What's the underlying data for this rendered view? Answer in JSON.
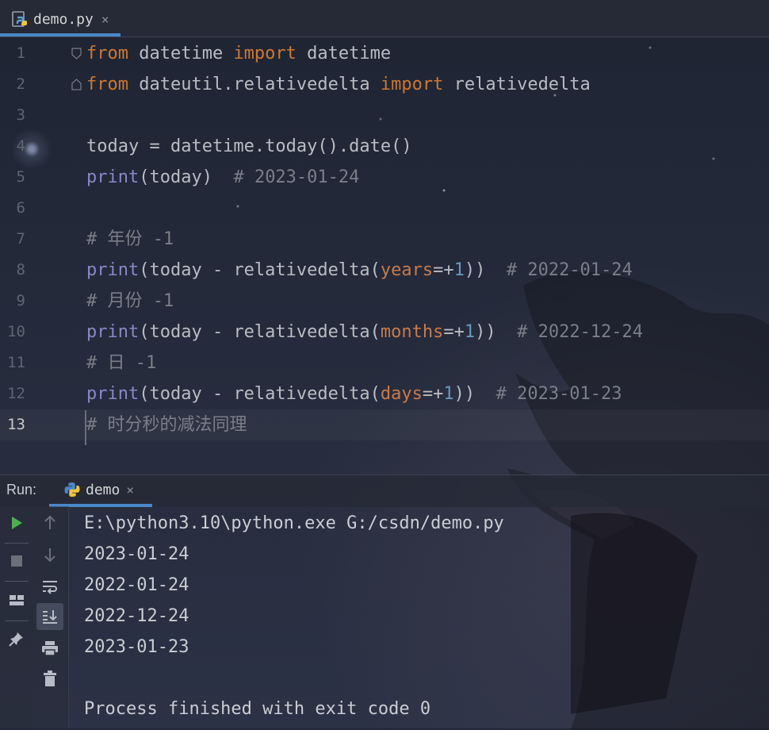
{
  "editor_tab": {
    "label": "demo.py",
    "close": "×"
  },
  "code_lines": [
    {
      "n": "1",
      "tokens": [
        {
          "t": "from",
          "c": "kw"
        },
        {
          "t": " datetime ",
          "c": "plain"
        },
        {
          "t": "import",
          "c": "kw"
        },
        {
          "t": " datetime",
          "c": "plain"
        }
      ]
    },
    {
      "n": "2",
      "tokens": [
        {
          "t": "from",
          "c": "kw"
        },
        {
          "t": " dateutil.relativedelta ",
          "c": "plain"
        },
        {
          "t": "import",
          "c": "kw"
        },
        {
          "t": " relativedelta",
          "c": "plain"
        }
      ]
    },
    {
      "n": "3",
      "tokens": []
    },
    {
      "n": "4",
      "tokens": [
        {
          "t": "today = datetime.today().date()",
          "c": "plain"
        }
      ]
    },
    {
      "n": "5",
      "tokens": [
        {
          "t": "print",
          "c": "fn"
        },
        {
          "t": "(today)  ",
          "c": "plain"
        },
        {
          "t": "# 2023-01-24",
          "c": "cm"
        }
      ]
    },
    {
      "n": "6",
      "tokens": []
    },
    {
      "n": "7",
      "tokens": [
        {
          "t": "# ",
          "c": "cm"
        },
        {
          "t": "年份",
          "c": "cmcn"
        },
        {
          "t": " -1",
          "c": "cm"
        }
      ]
    },
    {
      "n": "8",
      "tokens": [
        {
          "t": "print",
          "c": "fn"
        },
        {
          "t": "(today - relativedelta(",
          "c": "plain"
        },
        {
          "t": "years",
          "c": "param"
        },
        {
          "t": "=+",
          "c": "plain"
        },
        {
          "t": "1",
          "c": "num"
        },
        {
          "t": "))  ",
          "c": "plain"
        },
        {
          "t": "# 2022-01-24",
          "c": "cm"
        }
      ]
    },
    {
      "n": "9",
      "tokens": [
        {
          "t": "# ",
          "c": "cm"
        },
        {
          "t": "月份",
          "c": "cmcn"
        },
        {
          "t": " -1",
          "c": "cm"
        }
      ]
    },
    {
      "n": "10",
      "tokens": [
        {
          "t": "print",
          "c": "fn"
        },
        {
          "t": "(today - relativedelta(",
          "c": "plain"
        },
        {
          "t": "months",
          "c": "param"
        },
        {
          "t": "=+",
          "c": "plain"
        },
        {
          "t": "1",
          "c": "num"
        },
        {
          "t": "))  ",
          "c": "plain"
        },
        {
          "t": "# 2022-12-24",
          "c": "cm"
        }
      ]
    },
    {
      "n": "11",
      "tokens": [
        {
          "t": "# ",
          "c": "cm"
        },
        {
          "t": "日",
          "c": "cmcn"
        },
        {
          "t": " -1",
          "c": "cm"
        }
      ]
    },
    {
      "n": "12",
      "tokens": [
        {
          "t": "print",
          "c": "fn"
        },
        {
          "t": "(today - relativedelta(",
          "c": "plain"
        },
        {
          "t": "days",
          "c": "param"
        },
        {
          "t": "=+",
          "c": "plain"
        },
        {
          "t": "1",
          "c": "num"
        },
        {
          "t": "))  ",
          "c": "plain"
        },
        {
          "t": "# 2023-01-23",
          "c": "cm"
        }
      ]
    },
    {
      "n": "13",
      "tokens": [
        {
          "t": "# ",
          "c": "cm"
        },
        {
          "t": "时分秒的减法同理",
          "c": "cmcn"
        }
      ]
    }
  ],
  "current_line": "13",
  "run_panel": {
    "title": "Run:",
    "tab_label": "demo",
    "close": "×",
    "output": [
      "E:\\python3.10\\python.exe G:/csdn/demo.py",
      "2023-01-24",
      "2022-01-24",
      "2022-12-24",
      "2023-01-23",
      "",
      "Process finished with exit code 0"
    ]
  },
  "colors": {
    "keyword": "#cc7832",
    "builtin": "#8888c6",
    "param": "#c77a4a",
    "number": "#6897bb",
    "comment": "#7a7e88",
    "accent": "#4a88c7",
    "run_green": "#4caf50"
  },
  "icons": {
    "editor_tab": "python-file-icon",
    "run_tab": "python-icon",
    "toolbar_left": [
      "run-icon",
      "stop-icon",
      "layout-icon",
      "pin-icon"
    ],
    "toolbar_right": [
      "up-arrow-icon",
      "down-arrow-icon",
      "soft-wrap-icon",
      "scroll-to-end-icon",
      "print-icon",
      "trash-icon"
    ]
  }
}
